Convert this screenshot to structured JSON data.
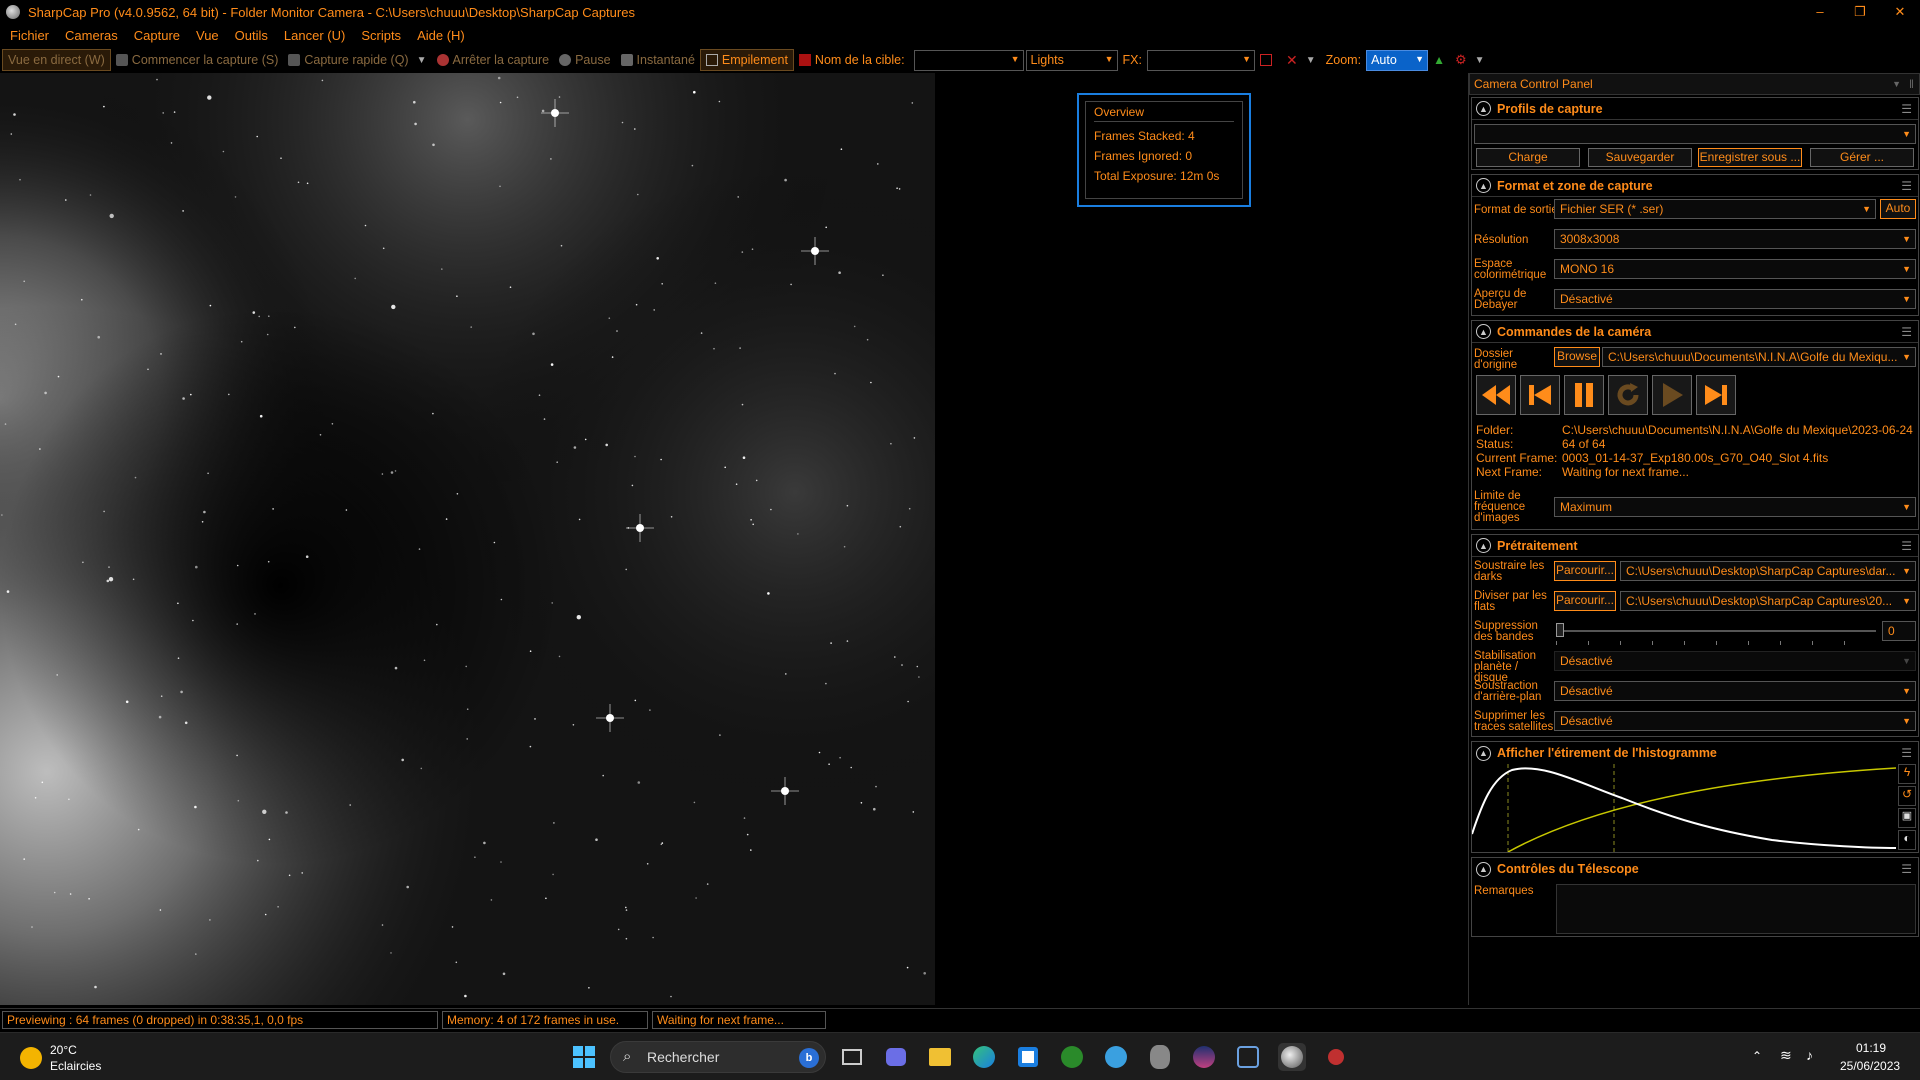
{
  "window": {
    "title": "SharpCap Pro (v4.0.9562, 64 bit) - Folder Monitor Camera - C:\\Users\\chuuu\\Desktop\\SharpCap Captures",
    "controls": [
      "–",
      "❐",
      "✕"
    ]
  },
  "menu": [
    "Fichier",
    "Cameras",
    "Capture",
    "Vue",
    "Outils",
    "Lancer (U)",
    "Scripts",
    "Aide (H)"
  ],
  "toolbar": {
    "live_view": "Vue en direct (W)",
    "start_capture": "Commencer la capture (S)",
    "quick_capture": "Capture rapide (Q)",
    "stop_capture": "Arrêter la capture",
    "pause": "Pause",
    "snapshot": "Instantané",
    "stacking": "Empilement",
    "target_name_label": "Nom de la cible:",
    "target_name_value": "",
    "frame_type": "Lights",
    "fx_label": "FX:",
    "fx_value": "",
    "zoom_label": "Zoom:",
    "zoom_value": "Auto"
  },
  "overview": {
    "title": "Overview",
    "frames_stacked": "Frames Stacked: 4",
    "frames_ignored": "Frames Ignored: 0",
    "total_exposure": "Total Exposure:   12m 0s"
  },
  "panel": {
    "title": "Camera Control Panel",
    "profiles": {
      "title": "Profils de capture",
      "selected": "",
      "buttons": [
        "Charge",
        "Sauvegarder",
        "Enregistrer sous ...",
        "Gérer ..."
      ]
    },
    "format": {
      "title": "Format et zone de capture",
      "output_label": "Format de sortie",
      "output_value": "Fichier SER (* .ser)",
      "auto_label": "Auto",
      "resolution_label": "Résolution",
      "resolution_value": "3008x3008",
      "colorspace_label": "Espace colorimétrique",
      "colorspace_value": "MONO 16",
      "debayer_label": "Aperçu de Debayer",
      "debayer_value": "Désactivé"
    },
    "camera": {
      "title": "Commandes de la caméra",
      "folder_label": "Dossier d'origine",
      "browse_label": "Browse",
      "folder_path": "C:\\Users\\chuuu\\Documents\\N.I.N.A\\Golfe du Mexiqu...",
      "info_labels": [
        "Folder:",
        "Status:",
        "Current Frame:",
        "Next Frame:"
      ],
      "info_values": [
        "C:\\Users\\chuuu\\Documents\\N.I.N.A\\Golfe du Mexique\\2023-06-24",
        "64 of 64",
        "0003_01-14-37_Exp180.00s_G70_O40_Slot 4.fits",
        "Waiting for next frame..."
      ],
      "framerate_label": "Limite de fréquence d'images",
      "framerate_value": "Maximum"
    },
    "preprocessing": {
      "title": "Prétraitement",
      "darks_label": "Soustraire les darks",
      "darks_button": "Parcourir...",
      "darks_path": "C:\\Users\\chuuu\\Desktop\\SharpCap Captures\\dar...",
      "flats_label": "Diviser par les flats",
      "flats_button": "Parcourir...",
      "flats_path": "C:\\Users\\chuuu\\Desktop\\SharpCap Captures\\20...",
      "banding_label": "Suppression des bandes",
      "banding_value": "0",
      "banding_level": 0,
      "stabilisation_label": "Stabilisation planète / disque",
      "stabilisation_value": "Désactivé",
      "background_label": "Soustraction d'arrière-plan",
      "background_value": "Désactivé",
      "satellite_label": "Supprimer les traces satellites",
      "satellite_value": "Désactivé"
    },
    "histogram": {
      "title": "Afficher l'étirement de l'histogramme"
    },
    "telescope": {
      "title": "Contrôles du Télescope",
      "notes_label": "Remarques",
      "notes_value": ""
    }
  },
  "status": {
    "preview": "Previewing : 64 frames (0 dropped) in 0:38:35,1, 0,0 fps",
    "memory": "Memory: 4 of 172 frames in use.",
    "waiting": "Waiting for next frame..."
  },
  "taskbar": {
    "temperature": "20°C",
    "weather": "Eclaircies",
    "search_placeholder": "Rechercher",
    "time": "01:19",
    "date": "25/06/2023"
  },
  "colors": {
    "accent": "#ff8c1a",
    "highlight_blue": "#1a7ee0",
    "background": "#000000"
  }
}
